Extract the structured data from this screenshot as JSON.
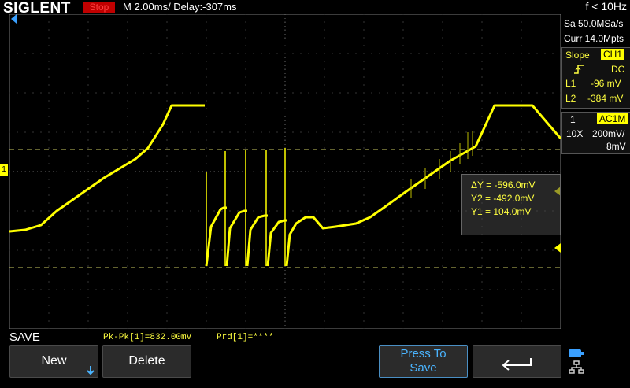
{
  "header": {
    "brand": "SIGLENT",
    "run_state": "Stop",
    "timebase": "M 2.00ms/ Delay:-307ms",
    "frequency": "f < 10Hz"
  },
  "right_panel": {
    "sample_rate": "Sa 50.0MSa/s",
    "memory_depth": "Curr 14.0Mpts",
    "trigger": {
      "label": "Slope",
      "source": "CH1",
      "coupling": "DC",
      "l1_label": "L1",
      "l1_value": "-96 mV",
      "l2_label": "L2",
      "l2_value": "-384 mV"
    },
    "channel": {
      "number": "1",
      "coupling": "AC1M",
      "probe": "10X",
      "volts_div": "200mV/",
      "offset": "8mV"
    }
  },
  "cursor_readout": {
    "delta_y": "ΔY = -596.0mV",
    "y2": "Y2 = -492.0mV",
    "y1": "Y1 = 104.0mV"
  },
  "channel_marker": "1",
  "measurements": {
    "pk_pk": "Pk-Pk[1]=832.00mV",
    "prd": "Prd[1]=****"
  },
  "softkeys": {
    "mode_label": "SAVE",
    "new": "New",
    "delete": "Delete",
    "press_to_save_line1": "Press To",
    "press_to_save_line2": "Save"
  },
  "colors": {
    "trace": "#ffff00",
    "stop_bg": "#c00000",
    "accent_blue": "#4ab4ff"
  }
}
